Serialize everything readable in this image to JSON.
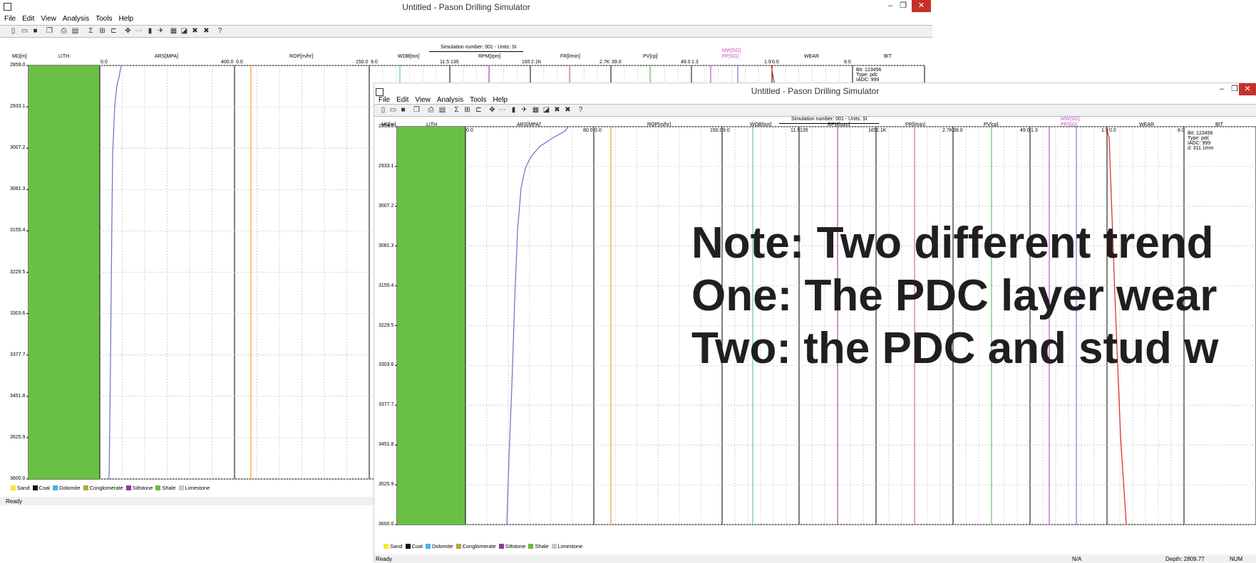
{
  "window_back": {
    "title": "Untitled - Pason Drilling Simulator",
    "menu": [
      "File",
      "Edit",
      "View",
      "Analysis",
      "Tools",
      "Help"
    ],
    "sim_header": "Simulation number: 001 - Units: SI",
    "headers": {
      "md": "MD[m]",
      "lith": "LITH",
      "ars": "ARS[MPA]",
      "ars_min": "0.0",
      "ars_max": "400.0",
      "rop": "ROP[m/hr]",
      "rop_min": "0.0",
      "rop_max": "150.0",
      "wob": "WOB[ton]",
      "wob_min": "9.0",
      "wob_max": "11.5",
      "rpm": "RPM[rpm]",
      "rpm_min": "135",
      "rpm_max": "165",
      "fr": "FR[l/min]",
      "fr_min": "2.1K",
      "fr_max": "2.7K",
      "pv": "PV[cp]",
      "pv_min": "39.0",
      "pv_max": "49.0",
      "mw": "MW[SG]",
      "pp": "PP[SG]",
      "mw_min": "1.3",
      "mw_max": "1.9",
      "wear": "WEAR",
      "wear_min": "0.0",
      "wear_max": "8.0",
      "bit": "BIT"
    },
    "depth_ticks": [
      "2859.0",
      "2933.1",
      "3007.2",
      "3081.3",
      "3155.4",
      "3229.5",
      "3303.6",
      "3377.7",
      "3451.8",
      "3525.9",
      "3600.0"
    ],
    "bit_info": [
      "Bit: 123456",
      "Type: pdc",
      "IADC: 999"
    ],
    "status": "Ready"
  },
  "window_front": {
    "title": "Untitled - Pason Drilling Simulator",
    "menu": [
      "File",
      "Edit",
      "View",
      "Analysis",
      "Tools",
      "Help"
    ],
    "sim_header": "Simulation number: 001 - Units: SI",
    "headers": {
      "md": "MD[m]",
      "lith": "LITH",
      "ars": "ARS[MPA]'",
      "ars_min": "0.0",
      "ars_max": "80.0",
      "rop": "ROP[m/hr]",
      "rop_min": "0.0",
      "rop_max": "150.0",
      "wob": "WOB[ton]",
      "wob_min": "9.0",
      "wob_max": "11.5",
      "rpm": "RPM[rpm]",
      "rpm_min": "135",
      "rpm_max": "165",
      "fr": "FR[l/min]",
      "fr_min": "2.1K",
      "fr_max": "2.7K",
      "pv": "PV[cp]",
      "pv_min": "39.0",
      "pv_max": "49.0",
      "mw": "MW[SG]",
      "pp": "PP[SG]",
      "mw_min": "1.3",
      "mw_max": "1.9",
      "wear": "WEAR",
      "wear_min": "0.0",
      "wear_max": "8.0",
      "bit": "BIT"
    },
    "depth_ticks": [
      "2859.0",
      "2933.1",
      "3007.2",
      "3081.3",
      "3155.4",
      "3229.5",
      "3303.6",
      "3377.7",
      "3451.8",
      "3525.9",
      "3600.0"
    ],
    "bit_info": [
      "Bit: 123456",
      "Type: pdc",
      "IADC: 999",
      "d: 311.1mm"
    ],
    "status": "Ready",
    "status_na": "N/A",
    "status_depth": "Depth: 2809.77",
    "status_num": "NUM"
  },
  "legend": [
    {
      "label": "Sand",
      "color": "#f5e830"
    },
    {
      "label": "Coal",
      "color": "#111111"
    },
    {
      "label": "Dolomite",
      "color": "#3fb6e6"
    },
    {
      "label": "Conglomerate",
      "color": "#b3a83a"
    },
    {
      "label": "Siltstone",
      "color": "#8a3a9a"
    },
    {
      "label": "Shale",
      "color": "#6aba44"
    },
    {
      "label": "Limestone",
      "color": "#c8c8c8"
    }
  ],
  "note": {
    "line1": "Note: Two different trend",
    "line2": "One: The PDC layer wear",
    "line3": "Two: the PDC and stud w"
  },
  "colors": {
    "lith_fill": "#6abf45",
    "ars": "#6b6bc8",
    "rop": "#f0a030",
    "wob": "#5fc8b0",
    "rpm": "#b04aa8",
    "fr": "#e06a6a",
    "pv": "#6ac06a",
    "mw": "#c050c0",
    "pp": "#8a70d0",
    "wear": "#e03030"
  }
}
